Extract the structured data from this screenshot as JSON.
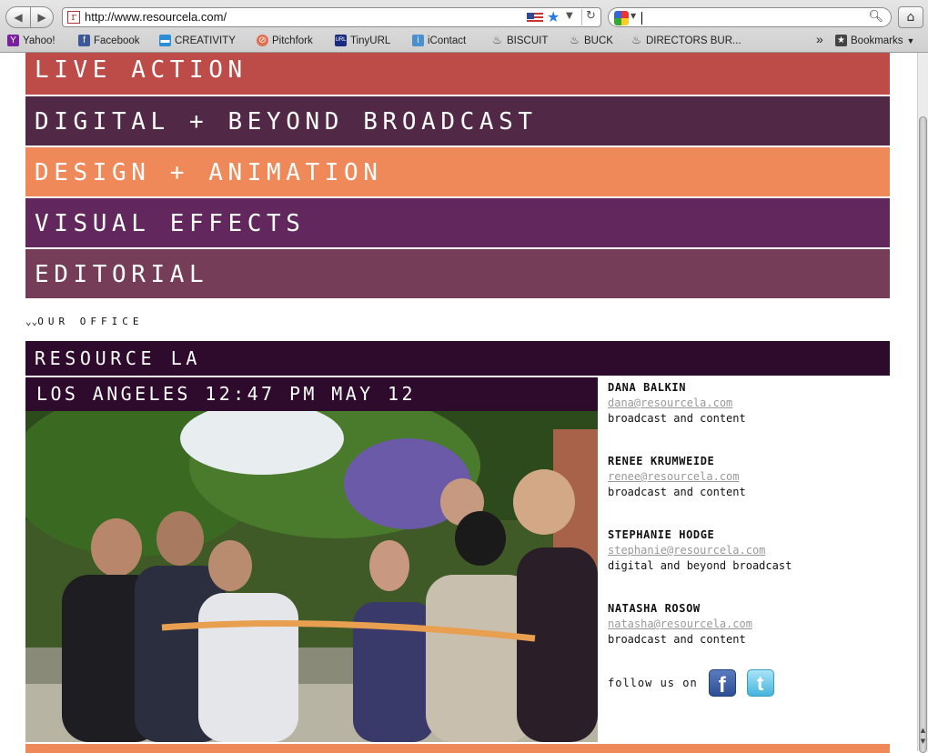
{
  "browser": {
    "url": "http://www.resourcela.com/",
    "bookmarks": [
      {
        "label": "Yahoo!",
        "icon": "yahoo-icon"
      },
      {
        "label": "Facebook",
        "icon": "facebook-icon"
      },
      {
        "label": "CREATIVITY",
        "icon": "creativity-icon"
      },
      {
        "label": "Pitchfork",
        "icon": "pitchfork-icon"
      },
      {
        "label": "TinyURL",
        "icon": "tinyurl-icon"
      },
      {
        "label": "iContact",
        "icon": "icontact-icon"
      },
      {
        "label": "BISCUIT",
        "icon": "flame-icon"
      },
      {
        "label": "BUCK",
        "icon": "flame-icon"
      },
      {
        "label": "DIRECTORS BUR...",
        "icon": "flame-icon"
      }
    ],
    "overflow": "»",
    "bookmarks_menu": "Bookmarks"
  },
  "nav": {
    "items": [
      "LIVE ACTION",
      "DIGITAL + BEYOND BROADCAST",
      "DESIGN + ANIMATION",
      "VISUAL EFFECTS",
      "EDITORIAL"
    ]
  },
  "office": {
    "toggle_label": "OUR OFFICE",
    "chevron": "⌄⌄",
    "name": "RESOURCE LA",
    "clock": "LOS ANGELES 12:47 PM MAY 12"
  },
  "contacts": [
    {
      "name": "DANA BALKIN",
      "email": "dana@resourcela.com",
      "role": "broadcast and content"
    },
    {
      "name": "RENEE KRUMWEIDE",
      "email": "renee@resourcela.com",
      "role": "broadcast and content"
    },
    {
      "name": "STEPHANIE HODGE",
      "email": "stephanie@resourcela.com",
      "role": "digital and beyond broadcast"
    },
    {
      "name": "NATASHA ROSOW",
      "email": "natasha@resourcela.com",
      "role": "broadcast and content"
    }
  ],
  "social": {
    "follow_label": "follow us on",
    "facebook_glyph": "f",
    "twitter_glyph": "t"
  },
  "colors": {
    "live_action": "#bd4b47",
    "digital": "#512845",
    "design": "#f0895a",
    "visual_effects": "#62285d",
    "editorial": "#763d58",
    "office_bar": "#2e0a2c"
  }
}
